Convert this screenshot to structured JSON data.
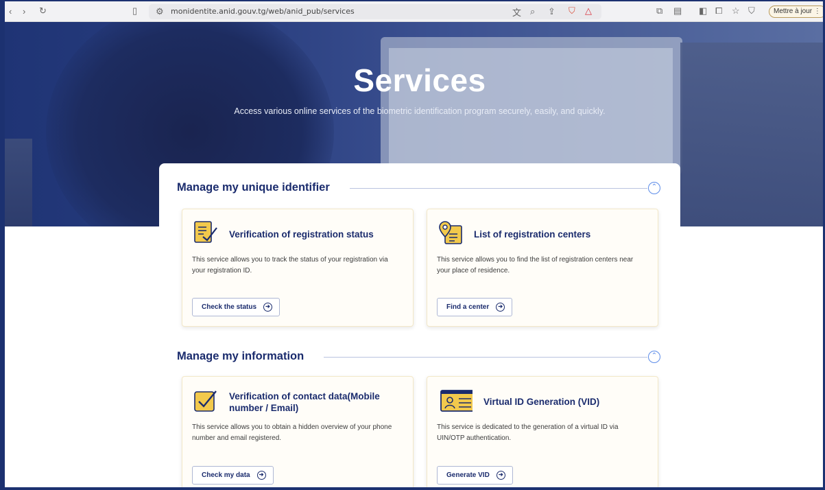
{
  "browser": {
    "url": "monidentite.anid.gouv.tg/web/anid_pub/services",
    "update_button": "Mettre à jour ⋮"
  },
  "hero": {
    "title": "Services",
    "subtitle": "Access various online services of the biometric identification program securely, easily, and quickly."
  },
  "sections": [
    {
      "title": "Manage my unique identifier",
      "cards": [
        {
          "title": "Verification of registration status",
          "description": "This service allows you to track the status of your registration via your registration ID.",
          "button": "Check the status",
          "icon": "document-check-icon"
        },
        {
          "title": "List of registration centers",
          "description": "This service allows you to find the list of registration centers near your place of residence.",
          "button": "Find a center",
          "icon": "map-pin-icon"
        }
      ]
    },
    {
      "title": "Manage my information",
      "cards": [
        {
          "title": "Verification of contact data(Mobile number / Email)",
          "description": "This service allows you to obtain a hidden overview of your phone number and email registered.",
          "button": "Check my data",
          "icon": "checkbox-icon"
        },
        {
          "title": "Virtual ID Generation (VID)",
          "description": "This service is dedicated to the generation of a virtual ID via UIN/OTP authentication.",
          "button": "Generate VID",
          "icon": "id-card-icon"
        }
      ]
    }
  ],
  "colors": {
    "brand_navy": "#1a2b6d",
    "accent_yellow": "#f2c94c",
    "collapse_blue": "#5b8be8"
  }
}
